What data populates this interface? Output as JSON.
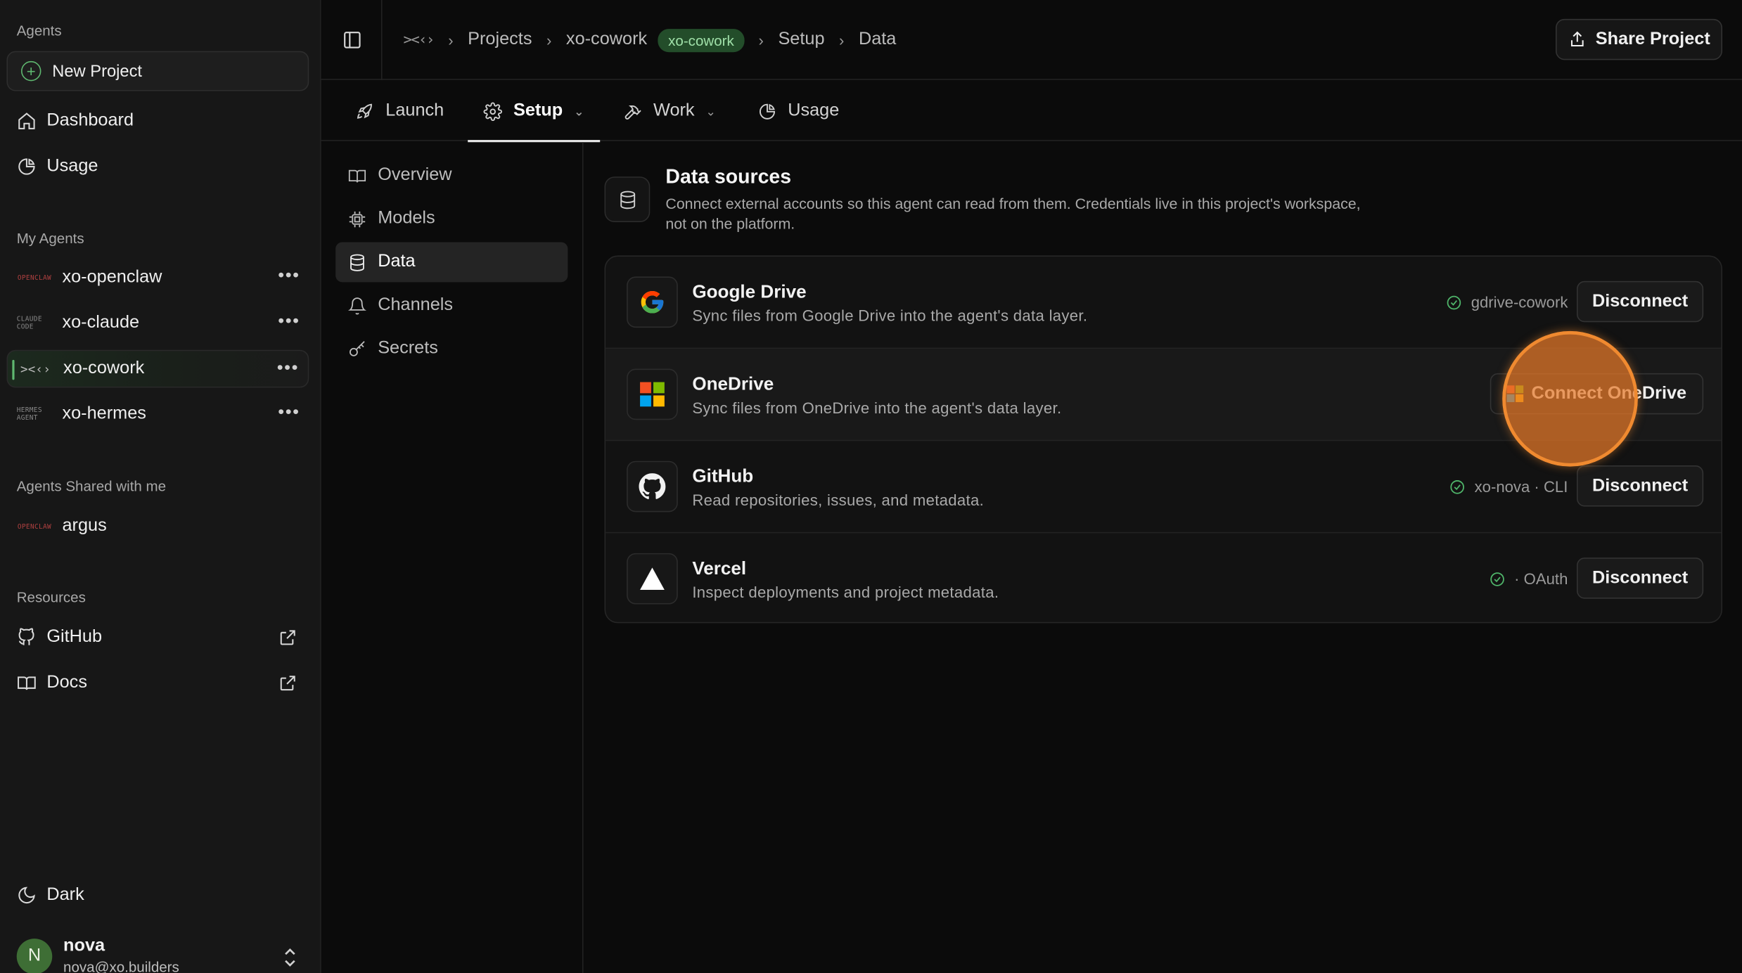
{
  "sidebar": {
    "agents_title": "Agents",
    "new_project": "New Project",
    "nav": [
      {
        "label": "Dashboard",
        "icon": "home-icon"
      },
      {
        "label": "Usage",
        "icon": "pie-chart-icon"
      }
    ],
    "my_agents_title": "My Agents",
    "my_agents": [
      {
        "label": "xo-openclaw",
        "logo": "OPENCLAW"
      },
      {
        "label": "xo-claude",
        "logo": "CLAUDE CODE"
      },
      {
        "label": "xo-cowork",
        "logo": "><‹›"
      },
      {
        "label": "xo-hermes",
        "logo": "HERMES AGENT"
      }
    ],
    "more": "•••",
    "shared_title": "Agents Shared with me",
    "shared_agents": [
      {
        "label": "argus",
        "logo": "OPENCLAW"
      }
    ],
    "resources_title": "Resources",
    "resources": [
      {
        "label": "GitHub",
        "icon": "github-icon"
      },
      {
        "label": "Docs",
        "icon": "book-icon"
      }
    ],
    "theme_label": "Dark",
    "user": {
      "initial": "N",
      "name": "nova",
      "email": "nova@xo.builders"
    }
  },
  "topbar": {
    "logo": "><‹›",
    "breadcrumbs": [
      "Projects",
      "xo-cowork",
      "Setup",
      "Data"
    ],
    "project_badge": "xo-cowork",
    "share_label": "Share Project"
  },
  "tabs": [
    {
      "label": "Launch",
      "icon": "rocket-icon"
    },
    {
      "label": "Setup",
      "icon": "gear-icon"
    },
    {
      "label": "Work",
      "icon": "hammer-icon"
    },
    {
      "label": "Usage",
      "icon": "pie-chart-icon"
    }
  ],
  "subnav": [
    {
      "label": "Overview",
      "icon": "book-icon"
    },
    {
      "label": "Models",
      "icon": "chip-icon"
    },
    {
      "label": "Data",
      "icon": "database-icon"
    },
    {
      "label": "Channels",
      "icon": "bell-icon"
    },
    {
      "label": "Secrets",
      "icon": "key-icon"
    }
  ],
  "main": {
    "title": "Data sources",
    "description": "Connect external accounts so this agent can read from them. Credentials live in this project's workspace, not on the platform.",
    "sources": [
      {
        "name": "Google Drive",
        "desc": "Sync files from Google Drive into the agent's data layer.",
        "status": "gdrive-cowork",
        "action": "Disconnect",
        "connected": true
      },
      {
        "name": "OneDrive",
        "desc": "Sync files from OneDrive into the agent's data layer.",
        "status": "",
        "action": "Connect OneDrive",
        "connected": false
      },
      {
        "name": "GitHub",
        "desc": "Read repositories, issues, and metadata.",
        "status": "xo-nova · CLI",
        "action": "Disconnect",
        "connected": true
      },
      {
        "name": "Vercel",
        "desc": "Inspect deployments and project metadata.",
        "status": "· OAuth",
        "action": "Disconnect",
        "connected": true
      }
    ]
  },
  "colors": {
    "accent": "#5fb870",
    "badge_bg": "#234d2a",
    "status_ok": "#4fb56a",
    "cursor": "#f08a30"
  }
}
